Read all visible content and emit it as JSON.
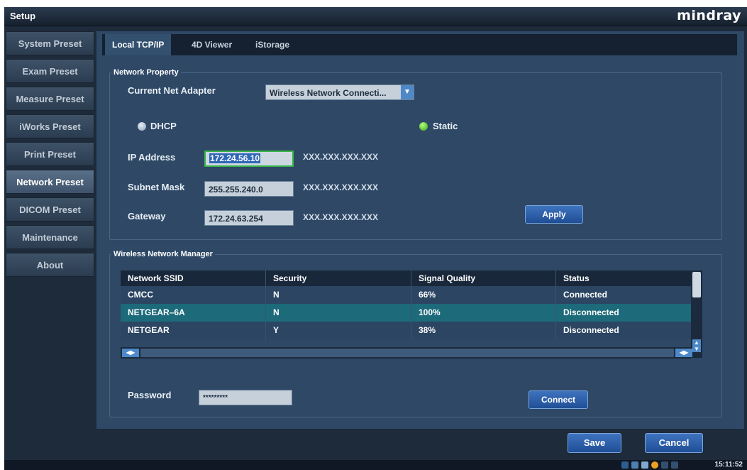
{
  "window": {
    "title": "Setup",
    "brand": "mindray"
  },
  "sidebar": {
    "items": [
      {
        "label": "System Preset"
      },
      {
        "label": "Exam Preset"
      },
      {
        "label": "Measure Preset"
      },
      {
        "label": "iWorks Preset"
      },
      {
        "label": "Print Preset"
      },
      {
        "label": "Network Preset",
        "active": true
      },
      {
        "label": "DICOM Preset"
      },
      {
        "label": "Maintenance"
      },
      {
        "label": "About"
      }
    ]
  },
  "tabs": [
    {
      "label": "Local TCP/IP",
      "active": true
    },
    {
      "label": "4D Viewer"
    },
    {
      "label": "iStorage"
    }
  ],
  "network_property": {
    "legend": "Network Property",
    "adapter_label": "Current Net Adapter",
    "adapter_value": "Wireless Network Connecti...",
    "dhcp_label": "DHCP",
    "static_label": "Static",
    "selected_mode": "Static",
    "ip_label": "IP Address",
    "ip_value": "172.24.56.10",
    "subnet_label": "Subnet Mask",
    "subnet_value": "255.255.240.0",
    "gateway_label": "Gateway",
    "gateway_value": "172.24.63.254",
    "format_hint": "XXX.XXX.XXX.XXX",
    "apply_label": "Apply"
  },
  "wireless": {
    "legend": "Wireless Network Manager",
    "columns": [
      "Network SSID",
      "Security",
      "Signal Quality",
      "Status"
    ],
    "rows": [
      [
        "CMCC",
        "N",
        "66%",
        "Connected"
      ],
      [
        "NETGEAR–6A",
        "N",
        "100%",
        "Disconnected"
      ],
      [
        "NETGEAR",
        "Y",
        "38%",
        "Disconnected"
      ]
    ],
    "highlighted_row": 1,
    "password_label": "Password",
    "password_value": "*********",
    "connect_label": "Connect"
  },
  "footer": {
    "save_label": "Save",
    "cancel_label": "Cancel",
    "clock": "15:11:52"
  },
  "colors": {
    "accent": "#3f73bf",
    "active_radio": "#2fa21e",
    "focus_border": "#38b449"
  }
}
